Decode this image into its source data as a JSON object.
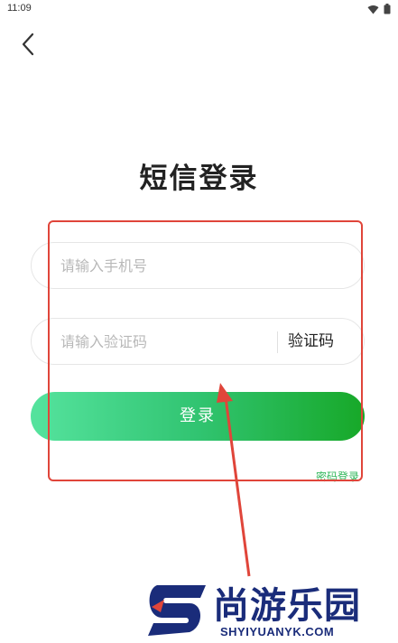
{
  "status_bar": {
    "time": "11:09",
    "icons": [
      "wifi-icon",
      "battery-icon"
    ]
  },
  "nav": {
    "back_icon": "chevron-left-icon"
  },
  "page": {
    "title": "短信登录"
  },
  "form": {
    "phone_placeholder": "请输入手机号",
    "phone_value": "",
    "code_placeholder": "请输入验证码",
    "code_value": "",
    "code_button_label": "验证码",
    "login_button_label": "登录",
    "password_login_link": "密码登录"
  },
  "watermark": {
    "brand": "尚游乐园",
    "domain": "SHYIYUANYK.COM"
  },
  "colors": {
    "accent_green": "#2fb75a",
    "annotation_red": "#e0453a",
    "watermark_blue": "#1a2c7a"
  }
}
